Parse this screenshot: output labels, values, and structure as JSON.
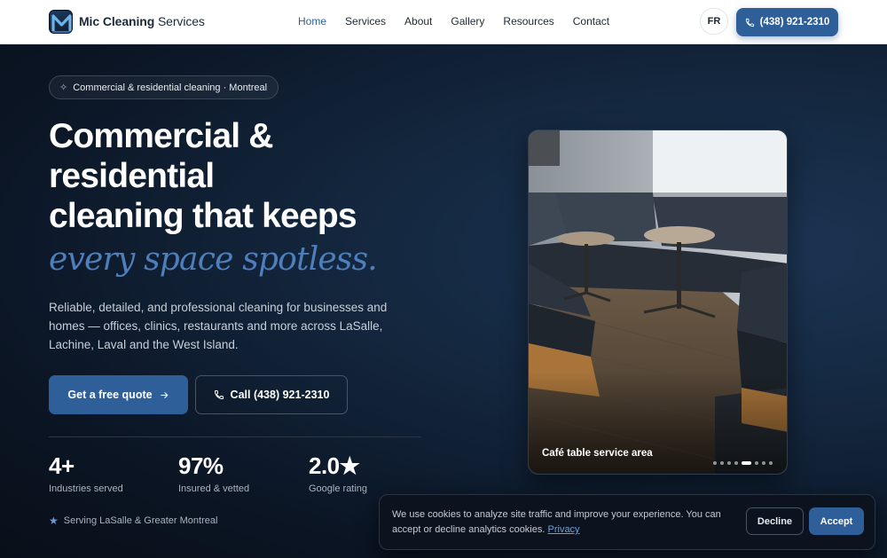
{
  "nav": {
    "brand_bold": "Mic Cleaning",
    "brand_rest": " Services",
    "links": [
      "Home",
      "Services",
      "About",
      "Gallery",
      "Resources",
      "Contact"
    ],
    "active_link": "Home",
    "lang_label": "FR",
    "call_label": "(438) 921-2310"
  },
  "hero": {
    "pill_text": "Commercial & residential cleaning · Montreal",
    "headline_lines": [
      "Commercial &",
      "residential",
      "cleaning that keeps"
    ],
    "headline_italic": "every space spotless.",
    "subtext": "Reliable, detailed, and professional cleaning for businesses and homes — offices, clinics, restaurants and more across LaSalle, Lachine, Laval and the West Island.",
    "cta_primary": "Get a free quote",
    "cta_secondary": "Call (438) 921-2310",
    "stats": [
      {
        "value": "4+",
        "label": "Industries served"
      },
      {
        "value": "97%",
        "label": "Insured & vetted"
      },
      {
        "value": "2.0★",
        "label": "Google rating"
      }
    ],
    "serving_text": "Serving LaSalle & Greater Montreal"
  },
  "gallery": {
    "caption": "Café table service area",
    "slide_count": 9,
    "active_slide": 5
  },
  "cookie": {
    "text": "We use cookies to analyze site traffic and improve your experience. You can accept or decline analytics cookies.",
    "link_text": "Privacy",
    "decline_label": "Decline",
    "accept_label": "Accept"
  },
  "colors": {
    "accent": "#2f5f99",
    "italic_accent": "#4e7fbd",
    "hero_bg": "#0d1a2b"
  }
}
